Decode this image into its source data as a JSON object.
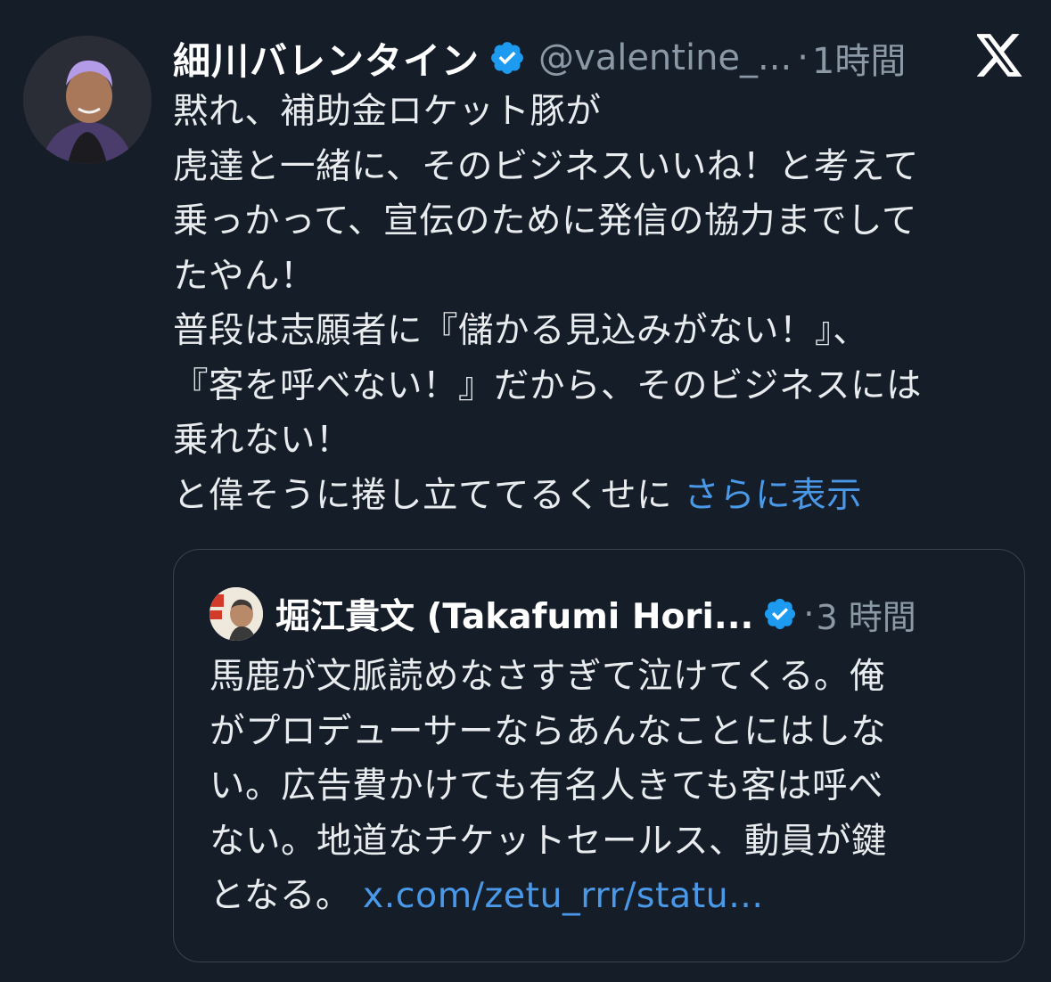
{
  "tweet": {
    "display_name": "細川バレンタイン",
    "handle": "@valentine_...",
    "separator": "·",
    "time": "1時間",
    "lines": [
      "黙れ、補助金ロケット豚が",
      "虎達と一緒に、そのビジネスいいね！と考えて",
      "乗っかって、宣伝のために発信の協力までして",
      "たやん！",
      "普段は志願者に『儲かる見込みがない！』、",
      "『客を呼べない！』だから、そのビジネスには",
      "乗れない！",
      "と偉そうに捲し立ててるくせに "
    ],
    "show_more": "さらに表示"
  },
  "quote": {
    "display_name": "堀江貴文 (Takafumi Hori...",
    "separator": "·",
    "time": "3 時間",
    "lines": [
      "馬鹿が文脈読めなさすぎて泣けてくる。俺",
      "がプロデューサーならあんなことにはしな",
      "い。広告費かけても有名人きても客は呼べ",
      "ない。地道なチケットセールス、動員が鍵",
      "となる。 "
    ],
    "link": "x.com/zetu_rrr/statu..."
  },
  "icons": {
    "verified": "verified-badge-icon",
    "x_logo": "x-logo-icon"
  },
  "colors": {
    "background": "#151d28",
    "text": "#e9ecee",
    "secondary": "#8b98a5",
    "link": "#4a99e9",
    "verified": "#1d9bf0",
    "border": "#38444d"
  }
}
